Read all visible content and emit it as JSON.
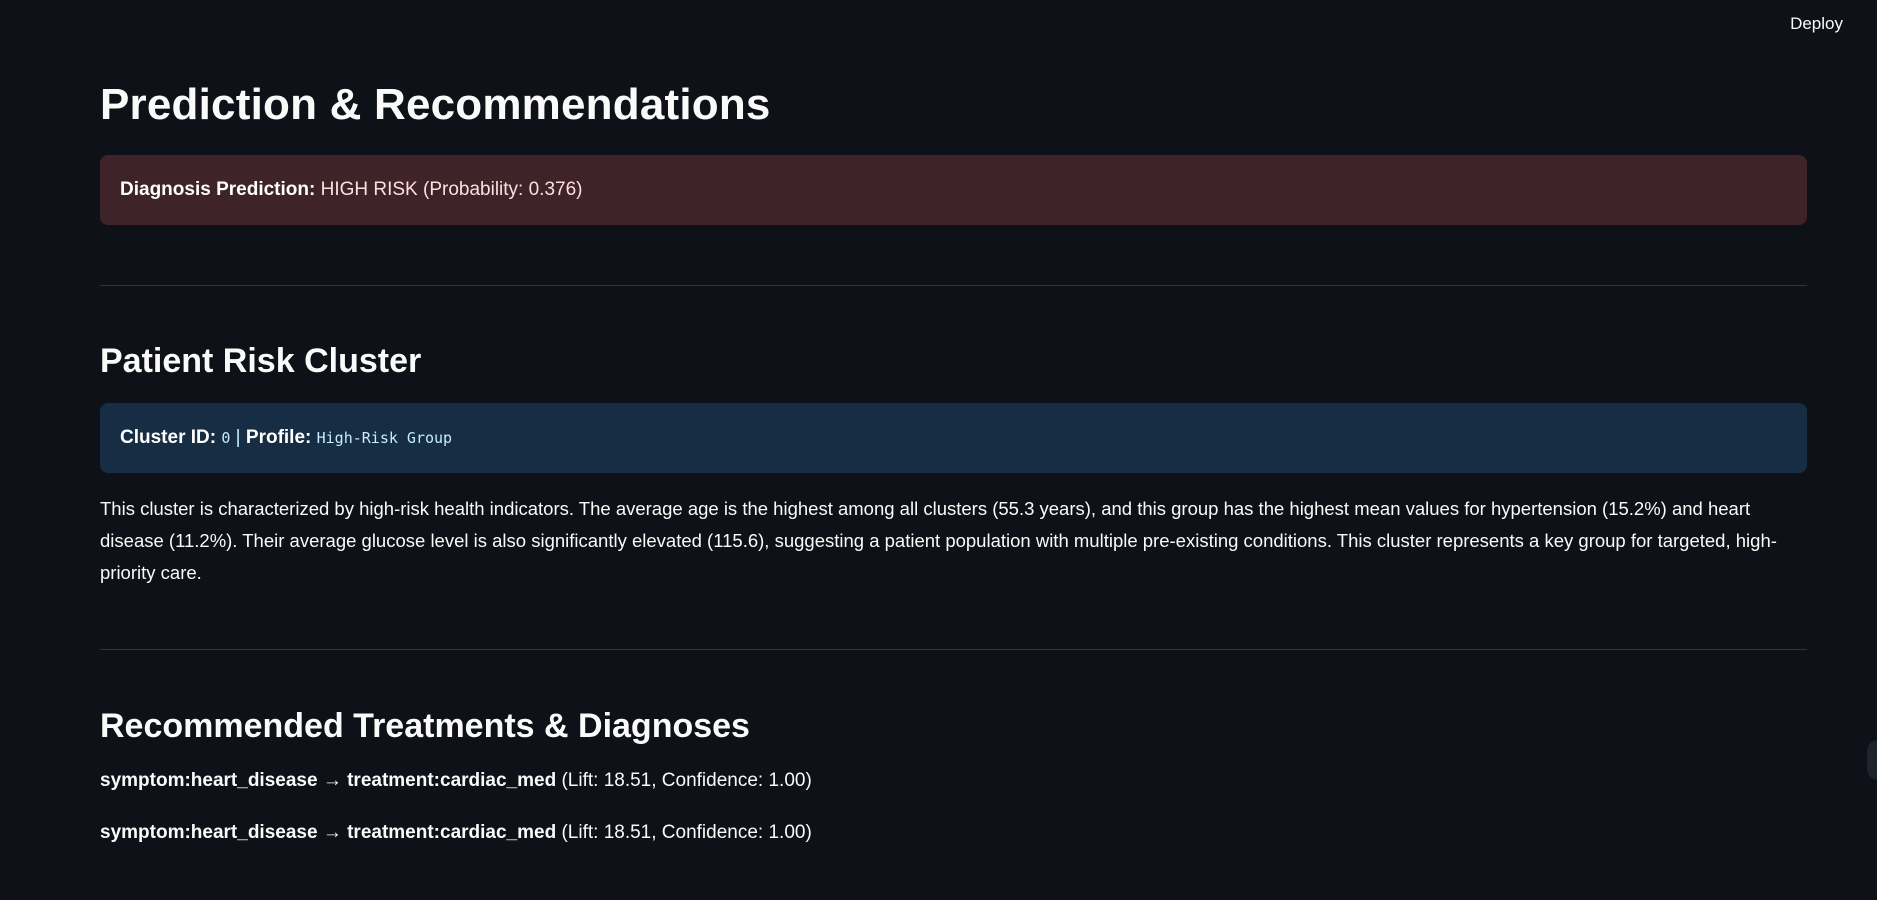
{
  "header": {
    "deploy_label": "Deploy"
  },
  "page": {
    "title": "Prediction & Recommendations"
  },
  "prediction": {
    "label": "Diagnosis Prediction:",
    "value": "HIGH RISK (Probability: 0.376)"
  },
  "cluster": {
    "heading": "Patient Risk Cluster",
    "id_label": "Cluster ID:",
    "id_value": "0",
    "separator": "|",
    "profile_label": "Profile:",
    "profile_value": "High-Risk Group",
    "description": "This cluster is characterized by high-risk health indicators. The average age is the highest among all clusters (55.3 years), and this group has the highest mean values for hypertension (15.2%) and heart disease (11.2%). Their average glucose level is also significantly elevated (115.6), suggesting a patient population with multiple pre-existing conditions. This cluster represents a key group for targeted, high-priority care."
  },
  "recommendations": {
    "heading": "Recommended Treatments & Diagnoses",
    "items": [
      {
        "rule": "symptom:heart_disease → treatment:cardiac_med",
        "metrics": "(Lift: 18.51, Confidence: 1.00)"
      },
      {
        "rule": "symptom:heart_disease → treatment:cardiac_med",
        "metrics": "(Lift: 18.51, Confidence: 1.00)"
      }
    ]
  },
  "colors": {
    "background": "#0e1117",
    "error_alert": "#3e2328",
    "info_alert": "#172d43",
    "divider": "#31333f"
  }
}
